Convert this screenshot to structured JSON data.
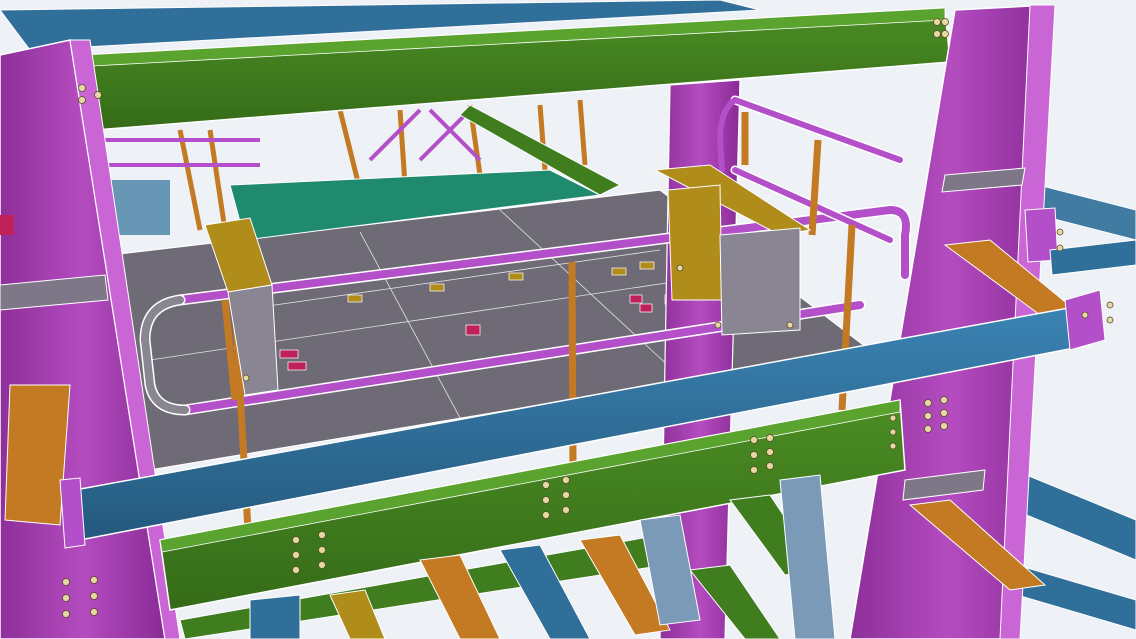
{
  "scene": {
    "kind": "3d-steel-structure-model-view",
    "colors": {
      "background": "#eef1f6",
      "column_magenta": "#a43db0",
      "beam_green": "#3f7d1e",
      "beam_blue": "#2f6f9a",
      "member_orange": "#c37a22",
      "plate_olive": "#b08c1a",
      "floor_grey": "#6f6b76",
      "floor_teal": "#1f8a6e",
      "handrail_purple": "#b34fc9",
      "bolt_cream": "#e6d7a3",
      "edge_white": "#ffffff"
    },
    "icons": [
      "bolt-group-icon"
    ]
  }
}
